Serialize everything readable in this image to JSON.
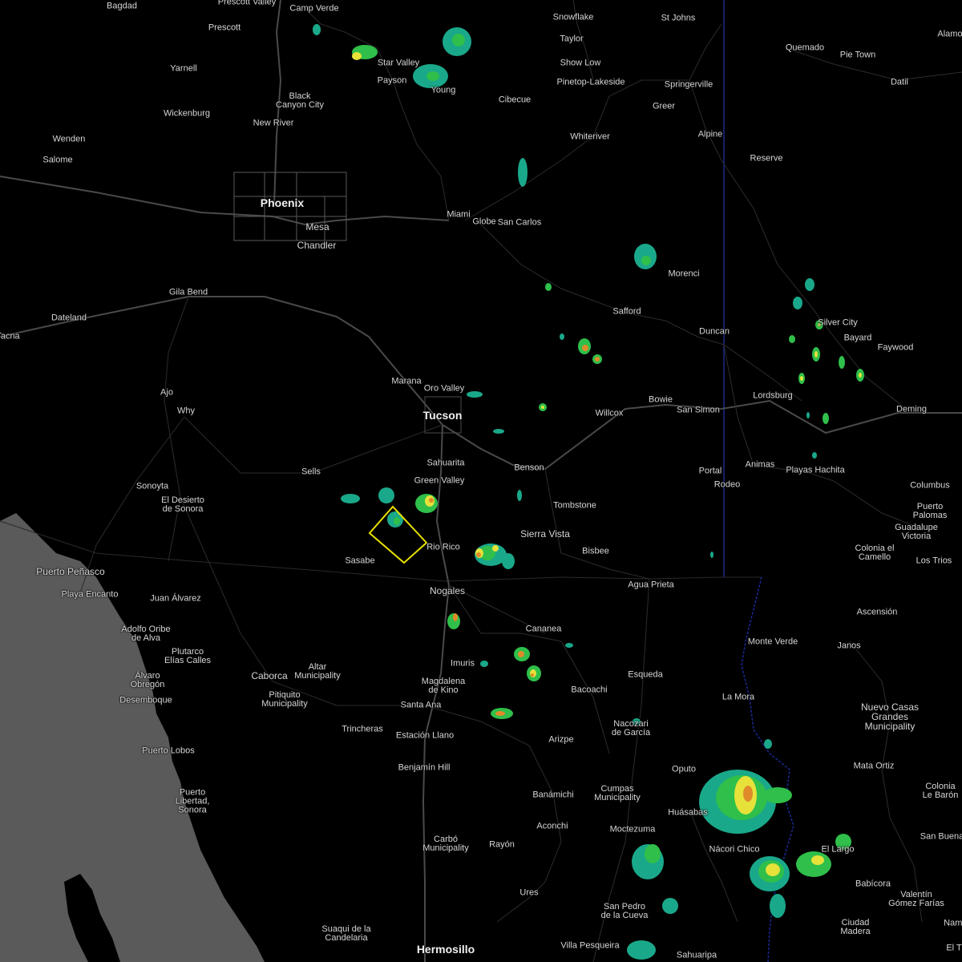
{
  "map": {
    "colors": {
      "background": "#000000",
      "ocean": "#5a5a5a",
      "roads": "#3a3a3a",
      "highways": "#4c4c4c",
      "state_border": "#1a2a7a",
      "warning_polygon": "#e8e000",
      "radar_light": "#1aa88a",
      "radar_green": "#2fbf4a",
      "radar_yellow": "#e6e23a",
      "radar_orange": "#e08a2a"
    },
    "labels": {
      "baghdad": "Bagdad",
      "prescott_valley": "Prescott Valley",
      "camp_verde": "Camp Verde",
      "prescott": "Prescott",
      "snowflake": "Snowflake",
      "st_johns": "St Johns",
      "alamo": "Alamo",
      "taylor": "Taylor",
      "star_valley": "Star Valley",
      "payson": "Payson",
      "show_low": "Show Low",
      "quemado": "Quemado",
      "pie_town": "Pie Town",
      "young": "Young",
      "pinetop": "Pinetop-Lakeside",
      "springerville": "Springerville",
      "datil": "Datil",
      "yarnell": "Yarnell",
      "black_canyon": "Black\nCanyon City",
      "cibecue": "Cibecue",
      "greer": "Greer",
      "wickenburg": "Wickenburg",
      "new_river": "New River",
      "whiteriver": "Whiteriver",
      "alpine": "Alpine",
      "wenden": "Wenden",
      "salome": "Salome",
      "reserve": "Reserve",
      "phoenix": "Phoenix",
      "mesa": "Mesa",
      "chandler": "Chandler",
      "miami": "Miami",
      "globe": "Globe",
      "san_carlos": "San Carlos",
      "morenci": "Morenci",
      "gila_bend": "Gila Bend",
      "safford": "Safford",
      "duncan": "Duncan",
      "silver_city": "Silver City",
      "bayard": "Bayard",
      "dateland": "Dateland",
      "tacna": "Tacna",
      "faywood": "Faywood",
      "marana": "Marana",
      "oro_valley": "Oro Valley",
      "ajo": "Ajo",
      "bowie": "Bowie",
      "lordsburg": "Lordsburg",
      "why": "Why",
      "tucson": "Tucson",
      "willcox": "Willcox",
      "san_simon": "San Simon",
      "deming": "Deming",
      "sells": "Sells",
      "sahuarita": "Sahuarita",
      "benson": "Benson",
      "animas": "Animas",
      "portal": "Portal",
      "rodeo": "Rodeo",
      "playas": "Playas Hachita",
      "sonoyta": "Sonoyta",
      "el_desierto": "El Desierto\nde Sonora",
      "green_valley": "Green Valley",
      "tombstone": "Tombstone",
      "columbus": "Columbus",
      "puerto_palomas": "Puerto\nPalomas",
      "guadalupe_victoria": "Guadalupe\nVictoria",
      "sierra_vista": "Sierra Vista",
      "colonia_camello": "Colonia el\nCamello",
      "los_trios": "Los Trios",
      "sasabe": "Sasabe",
      "rio_rico": "Rio Rico",
      "bisbee": "Bisbee",
      "puerto_penasco": "Puerto Peñasco",
      "playa_encanto": "Playa Encanto",
      "agua_prieta": "Agua Prieta",
      "nogales": "Nogales",
      "juan_alvarez": "Juan Álvarez",
      "ascension": "Ascensión",
      "adolfo_oribe": "Adolfo Oribe\nde Alva",
      "cananea": "Cananea",
      "monte_verde": "Monte Verde",
      "janos": "Janos",
      "plutarco": "Plutarco\nElías Calles",
      "imuris": "Imuris",
      "alvaro_obregon": "Álvaro\nObregón",
      "caborca": "Caborca",
      "altar": "Altar\nMunicipality",
      "magdalena": "Magdalena\nde Kino",
      "esqueda": "Esqueda",
      "bacoachi": "Bacoachi",
      "pitiquito": "Pitiquito\nMunicipality",
      "desemboque": "Desemboque",
      "la_mora": "La Mora",
      "nuevo_casas": "Nuevo Casas\nGrandes\nMunicipality",
      "santa_ana": "Santa Ana",
      "nacozari": "Nacozari\nde García",
      "trincheras": "Trincheras",
      "estacion_llano": "Estación Llano",
      "arizpe": "Arizpe",
      "puerto_lobos": "Puerto Lobos",
      "benjamin_hill": "Benjamín Hill",
      "oputo": "Oputo",
      "mata_ortiz": "Mata Ortiz",
      "colonia_le_baron": "Colonia\nLe Barón",
      "cumpas": "Cumpas\nMunicipality",
      "banamichi": "Banámichi",
      "puerto_libertad": "Puerto\nLibertad,\nSonora",
      "huasabas": "Huásabas",
      "san_buena": "San Buena",
      "aconchi": "Aconchi",
      "moctezuma": "Moctezuma",
      "carbo": "Carbó\nMunicipality",
      "nacori_chico": "Nácori Chico",
      "el_largo": "El Largo",
      "rayon": "Rayón",
      "babicora": "Babícora",
      "valentin": "Valentín\nGómez Farías",
      "ures": "Ures",
      "san_pedro": "San Pedro\nde la Cueva",
      "ciudad_madera": "Ciudad\nMadera",
      "namiquipa": "Nami",
      "suaqui": "Suaqui de la\nCandelaria",
      "villa_pesqueira": "Villa Pesqueira",
      "hermosillo": "Hermosillo",
      "sahuaripa": "Sahuaripa",
      "el_t": "El T"
    }
  }
}
